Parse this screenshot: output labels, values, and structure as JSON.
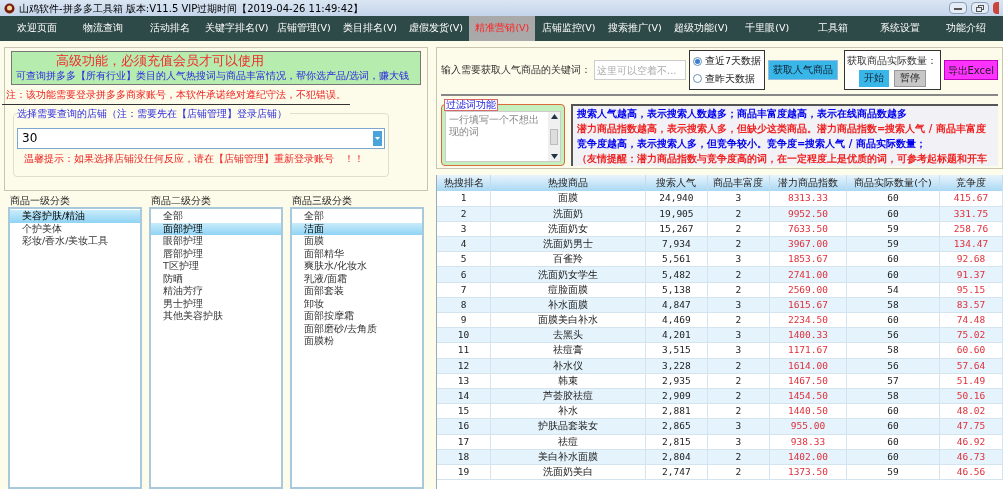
{
  "window": {
    "title": "山鸡软件-拼多多工具箱 版本:V11.5 VIP过期时间【2019-04-26 11:49:42】"
  },
  "nav": [
    {
      "label": "欢迎页面",
      "selected": false
    },
    {
      "label": "物流查询",
      "selected": false
    },
    {
      "label": "活动排名",
      "selected": false
    },
    {
      "label": "关键字排名(V)",
      "selected": false
    },
    {
      "label": "店铺管理(V)",
      "selected": false
    },
    {
      "label": "类目排名(V)",
      "selected": false
    },
    {
      "label": "虚假发货(V)",
      "selected": false
    },
    {
      "label": "精准营销(V)",
      "selected": true
    },
    {
      "label": "店铺监控(V)",
      "selected": false
    },
    {
      "label": "搜索推广(V)",
      "selected": false
    },
    {
      "label": "超级功能(V)",
      "selected": false
    },
    {
      "label": "千里眼(V)",
      "selected": false
    },
    {
      "label": "工具箱",
      "selected": false
    },
    {
      "label": "系统设置",
      "selected": false
    },
    {
      "label": "功能介绍",
      "selected": false
    }
  ],
  "notice": {
    "title": "高级功能，必须充值会员才可以使用",
    "subtitle": "可查询拼多多【所有行业】类目的人气热搜词与商品丰富情况，帮你选产品/选词，赚大钱"
  },
  "note": "注：该功能需要登录拼多多商家账号，本软件承诺绝对遵纪守法，不犯错误。",
  "store": {
    "label": "选择需要查询的店铺（注：需要先在【店铺管理】登录店铺）",
    "value": "30",
    "hint": "温馨提示：如果选择店铺没任何反应，请在【店铺管理】重新登录账号　！！"
  },
  "categories": [
    {
      "title": "商品一级分类",
      "items": [
        {
          "label": "美容护肤/精油",
          "selected": true
        },
        {
          "label": "个护美体",
          "selected": false
        },
        {
          "label": "彩妆/香水/美妆工具",
          "selected": false
        }
      ]
    },
    {
      "title": "商品二级分类",
      "items": [
        {
          "label": "全部",
          "selected": false
        },
        {
          "label": "面部护理",
          "selected": true
        },
        {
          "label": "眼部护理",
          "selected": false
        },
        {
          "label": "唇部护理",
          "selected": false
        },
        {
          "label": "T区护理",
          "selected": false
        },
        {
          "label": "防晒",
          "selected": false
        },
        {
          "label": "精油芳疗",
          "selected": false
        },
        {
          "label": "男士护理",
          "selected": false
        },
        {
          "label": "其他美容护肤",
          "selected": false
        }
      ]
    },
    {
      "title": "商品三级分类",
      "items": [
        {
          "label": "全部",
          "selected": false
        },
        {
          "label": "洁面",
          "selected": true
        },
        {
          "label": "面膜",
          "selected": false
        },
        {
          "label": "面部精华",
          "selected": false
        },
        {
          "label": "爽肤水/化妆水",
          "selected": false
        },
        {
          "label": "乳液/面霜",
          "selected": false
        },
        {
          "label": "面部套装",
          "selected": false
        },
        {
          "label": "卸妆",
          "selected": false
        },
        {
          "label": "面部按摩霜",
          "selected": false
        },
        {
          "label": "面部磨砂/去角质",
          "selected": false
        },
        {
          "label": "面膜粉",
          "selected": false
        }
      ]
    }
  ],
  "keyword": {
    "label": "输入需要获取人气商品的关键词：",
    "placeholder": "这里可以空着不..."
  },
  "range": [
    {
      "label": "查近7天数据",
      "selected": true
    },
    {
      "label": "查昨天数据",
      "selected": false
    }
  ],
  "fetch_button": "获取人气商品",
  "count": {
    "label": "获取商品实际数量：",
    "start": "开始",
    "pause": "暂停"
  },
  "export_button": "导出Excel",
  "filter": {
    "legend": "过滤词功能",
    "placeholder": "一行填写一个不想出现的词"
  },
  "info": [
    {
      "text": "搜索人气越高，表示搜索人数越多；商品丰富度越高，表示在线商品数越多",
      "color": "#0000ee"
    },
    {
      "text": "潜力商品指数越高，表示搜索人多，但缺少这类商品。潜力商品指数=搜索人气 / 商品丰富度",
      "color": "#ee2222"
    },
    {
      "text": "竞争度越高，表示搜索人多，但竞争较小。竞争度=搜索人气 / 商品实际数量；",
      "color": "#0000ee"
    },
    {
      "text": "（友情提醒：潜力商品指数与竞争度高的词，在一定程度上是优质的词，可参考起标题和开车",
      "color": "#ee2222"
    }
  ],
  "table": {
    "columns": [
      "热搜排名",
      "热搜商品",
      "搜索人气",
      "商品丰富度",
      "潜力商品指数",
      "商品实际数量(个)",
      "竞争度"
    ],
    "rows": [
      [
        "1",
        "面膜",
        "24,940",
        "3",
        "8313.33",
        "60",
        "415.67"
      ],
      [
        "2",
        "洗面奶",
        "19,905",
        "2",
        "9952.50",
        "60",
        "331.75"
      ],
      [
        "3",
        "洗面奶女",
        "15,267",
        "2",
        "7633.50",
        "59",
        "258.76"
      ],
      [
        "4",
        "洗面奶男士",
        "7,934",
        "2",
        "3967.00",
        "59",
        "134.47"
      ],
      [
        "5",
        "百雀羚",
        "5,561",
        "3",
        "1853.67",
        "60",
        "92.68"
      ],
      [
        "6",
        "洗面奶女学生",
        "5,482",
        "2",
        "2741.00",
        "60",
        "91.37"
      ],
      [
        "7",
        "痘脸面膜",
        "5,138",
        "2",
        "2569.00",
        "54",
        "95.15"
      ],
      [
        "8",
        "补水面膜",
        "4,847",
        "3",
        "1615.67",
        "58",
        "83.57"
      ],
      [
        "9",
        "面膜美白补水",
        "4,469",
        "2",
        "2234.50",
        "60",
        "74.48"
      ],
      [
        "10",
        "去黑头",
        "4,201",
        "3",
        "1400.33",
        "56",
        "75.02"
      ],
      [
        "11",
        "祛痘膏",
        "3,515",
        "3",
        "1171.67",
        "58",
        "60.60"
      ],
      [
        "12",
        "补水仪",
        "3,228",
        "2",
        "1614.00",
        "56",
        "57.64"
      ],
      [
        "13",
        "韩束",
        "2,935",
        "2",
        "1467.50",
        "57",
        "51.49"
      ],
      [
        "14",
        "芦荟胶祛痘",
        "2,909",
        "2",
        "1454.50",
        "58",
        "50.16"
      ],
      [
        "15",
        "补水",
        "2,881",
        "2",
        "1440.50",
        "60",
        "48.02"
      ],
      [
        "16",
        "护肤品套装女",
        "2,865",
        "3",
        "955.00",
        "60",
        "47.75"
      ],
      [
        "17",
        "祛痘",
        "2,815",
        "3",
        "938.33",
        "60",
        "46.92"
      ],
      [
        "18",
        "美白补水面膜",
        "2,804",
        "2",
        "1402.00",
        "60",
        "46.73"
      ],
      [
        "19",
        "洗面奶美白",
        "2,747",
        "2",
        "1373.50",
        "59",
        "46.56"
      ]
    ]
  }
}
